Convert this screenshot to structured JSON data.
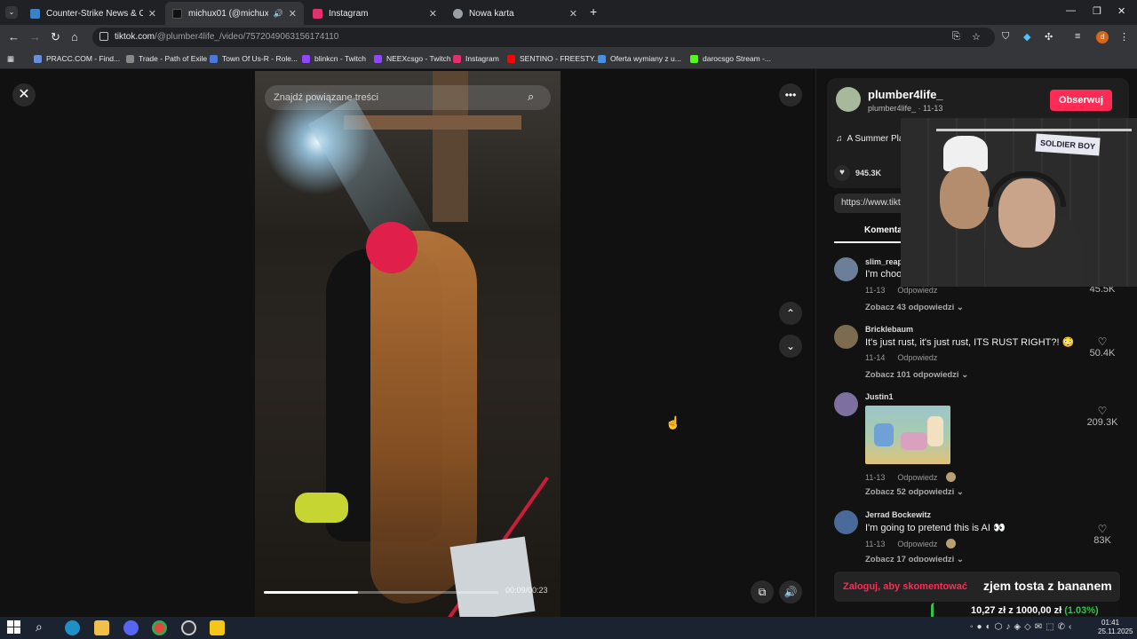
{
  "browser": {
    "tabs": [
      {
        "title": "Counter-Strike News & Coverag",
        "color": "#3b82c4",
        "active": false
      },
      {
        "title": "michux01 (@michux01) | Ti",
        "color": "#111111",
        "active": true
      },
      {
        "title": "Instagram",
        "color": "#e1306c",
        "active": false
      },
      {
        "title": "Nowa karta",
        "color": "#9aa0a6",
        "active": false
      }
    ],
    "url_host": "tiktok.com",
    "url_path": "/@plumber4life_/video/7572049063156174110",
    "profile_initial": "d",
    "bookmarks": [
      {
        "label": "PRACC.COM - Find...",
        "color": "#6a8fd8"
      },
      {
        "label": "Trade - Path of Exile",
        "color": "#888888"
      },
      {
        "label": "Town Of Us-R - Role...",
        "color": "#4a7bd8"
      },
      {
        "label": "blinkcn - Twitch",
        "color": "#9146ff"
      },
      {
        "label": "NEEXcsgo - Twitch",
        "color": "#9146ff"
      },
      {
        "label": "Instagram",
        "color": "#e1306c"
      },
      {
        "label": "SENTINO - FREESTY...",
        "color": "#ff0000"
      },
      {
        "label": "Oferta wymiany z u...",
        "color": "#4a90e2"
      },
      {
        "label": "darocsgo Stream -...",
        "color": "#53fc18"
      }
    ]
  },
  "video": {
    "search_placeholder": "Znajdź powiązane treści",
    "time": "00:09/00:23",
    "progress": 0.4
  },
  "panel": {
    "author_name": "plumber4life_",
    "author_sub": "plumber4life_ · 11-13",
    "follow_label": "Obserwuj",
    "music": "A Summer Pla",
    "likes": "945.3K",
    "link": "https://www.tikt",
    "comments_tab": "Komentar",
    "reply_label": "Odpowiedz",
    "comments": [
      {
        "user": "slim_reap",
        "text": "I'm choo",
        "date": "11-13",
        "likes": "45.5K",
        "more": "Zobacz 43 odpowiedzi ⌄",
        "avatar": "#6b7f99"
      },
      {
        "user": "Bricklebaum",
        "text": "It's just rust, it's just rust, ITS RUST RIGHT?! 😳",
        "date": "11-14",
        "likes": "50.4K",
        "more": "Zobacz 101 odpowiedzi ⌄",
        "avatar": "#7d6b4f"
      },
      {
        "user": "Justin1",
        "text": "",
        "date": "11-13",
        "likes": "209.3K",
        "more": "Zobacz 52 odpowiedzi ⌄",
        "avatar": "#7e6fa1"
      },
      {
        "user": "Jerrad Bockewitz",
        "text": "I'm going to pretend this is AI 👀",
        "date": "11-13",
        "likes": "83K",
        "more": "Zobacz 17 odpowiedzi ⌄",
        "avatar": "#4a6a9a"
      }
    ],
    "login_prompt": "Zaloguj, aby skomentować",
    "overlay_text": "zjem tosta z bananem"
  },
  "stream": {
    "webcam_sign": "SOLDIER BOY",
    "donation_amount": "10,27 zł",
    "donation_sep": " z ",
    "donation_goal": "1000,00 zł",
    "donation_pct": "(1.03%)"
  },
  "taskbar": {
    "time": "01:41",
    "date": "25.11.2025",
    "apps": [
      {
        "name": "edge",
        "color": "#1e90c8"
      },
      {
        "name": "explorer",
        "color": "#f0c04a"
      },
      {
        "name": "discord",
        "color": "#5865f2"
      },
      {
        "name": "chrome",
        "color": "#e8453c"
      },
      {
        "name": "steam",
        "color": "#2a2f3a"
      },
      {
        "name": "app",
        "color": "#f5c518"
      }
    ]
  }
}
